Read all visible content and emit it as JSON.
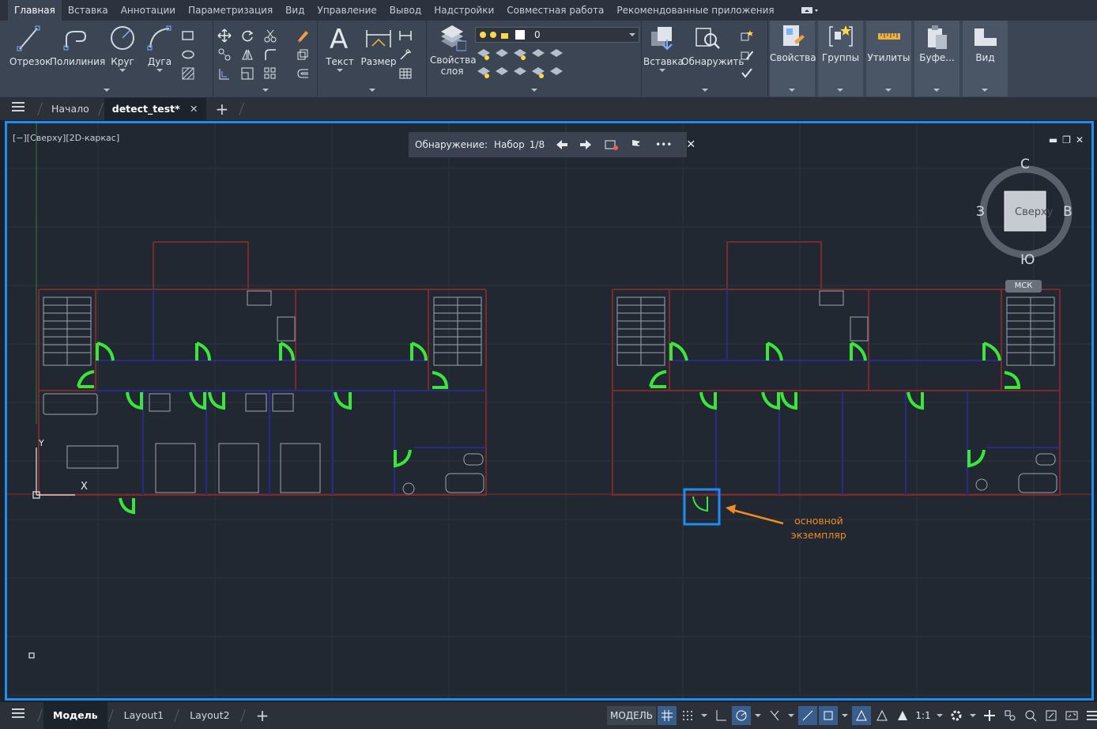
{
  "ribbon_tabs": [
    "Главная",
    "Вставка",
    "Аннотации",
    "Параметризация",
    "Вид",
    "Управление",
    "Вывод",
    "Надстройки",
    "Совместная работа",
    "Рекомендованные приложения"
  ],
  "ribbon": {
    "draw": {
      "line": "Отрезок",
      "polyline": "Полилиния",
      "circle": "Круг",
      "arc": "Дуга"
    },
    "annotation": {
      "text": "Текст",
      "dimension": "Размер"
    },
    "layers": {
      "layer_props_line1": "Свойства",
      "layer_props_line2": "слоя",
      "current_layer": "0"
    },
    "block": {
      "insert": "Вставка",
      "detect": "Обнаружить"
    },
    "properties": "Свойства",
    "groups": "Группы",
    "utilities": "Утилиты",
    "clipboard": "Буфе...",
    "view": "Вид"
  },
  "file_tabs": {
    "home": "Начало",
    "drawing": "detect_test*"
  },
  "viewport": {
    "label": "[−][Сверху][2D-каркас]",
    "detect_bar": {
      "title": "Обнаружение:",
      "set": "Набор",
      "counter": "1/8"
    },
    "viewcube": {
      "north": "С",
      "south": "Ю",
      "west": "З",
      "east": "В",
      "face": "Сверху",
      "wcs": "МСК"
    },
    "ucs": {
      "y": "Y",
      "x": "X"
    },
    "callout_line1": "основной",
    "callout_line2": "экземпляр"
  },
  "status": {
    "model": "Модель",
    "layout1": "Layout1",
    "layout2": "Layout2",
    "model_space": "МОДЕЛЬ",
    "scale": "1:1"
  },
  "colors": {
    "accent": "#1e8cf0",
    "door": "#39e639",
    "callout": "#f08a24",
    "wall": "#7a2a2a",
    "partition": "#2a2a8a"
  }
}
